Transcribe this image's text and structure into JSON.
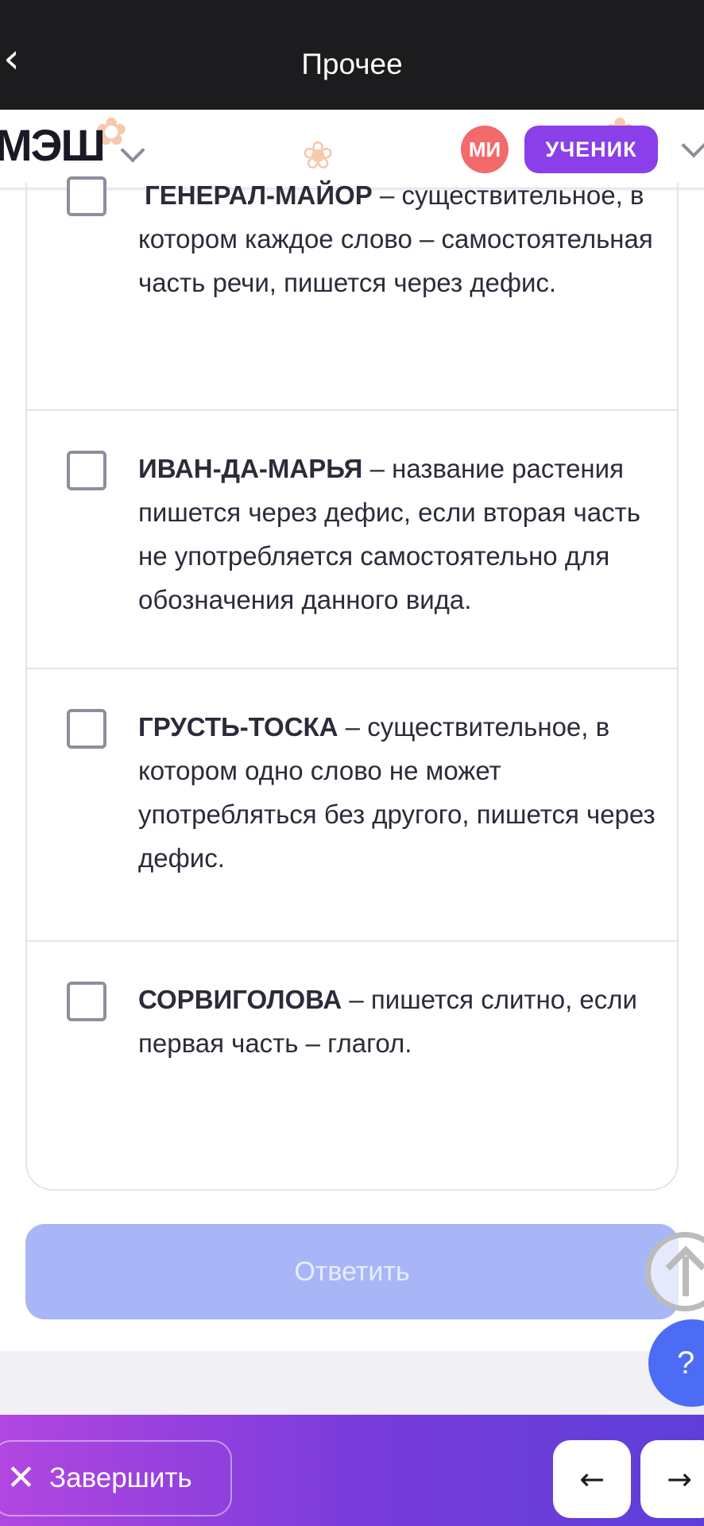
{
  "topbar": {
    "back_icon": "chevron-left-icon",
    "title": "Прочее"
  },
  "header": {
    "logo": "МЭШ",
    "avatar_initials": "МИ",
    "role": "УЧЕНИК",
    "avatar_color": "#f36a6a",
    "role_color": "#8a3fe8"
  },
  "options": [
    {
      "term": "ГЕНЕРАЛ-МАЙОР",
      "rest": " – существительное, в котором каждое слово – самостоятельная часть речи, пишется через дефис."
    },
    {
      "term": "ИВАН-ДА-МАРЬЯ",
      "rest": " – название растения пишется через дефис, если вторая часть не употребляется самостоятельно для обозначения данного вида."
    },
    {
      "term": "ГРУСТЬ-ТОСКА",
      "rest": " – существительное, в котором одно слово не может употребляться без другого, пишется через дефис."
    },
    {
      "term": "СОРВИГОЛОВА",
      "rest": " – пишется слитно, если первая часть – глагол."
    }
  ],
  "answer_button": "Ответить",
  "help_label": "?",
  "bottom": {
    "finish_label": "Завершить",
    "prev_icon": "arrow-left-icon",
    "next_icon": "arrow-right-icon",
    "prev_glyph": "←",
    "next_glyph": "→",
    "finish_glyph": "✕"
  },
  "colors": {
    "accent": "#8a3fe8",
    "button_disabled": "#a8b6f7",
    "help": "#4c6cf5"
  }
}
